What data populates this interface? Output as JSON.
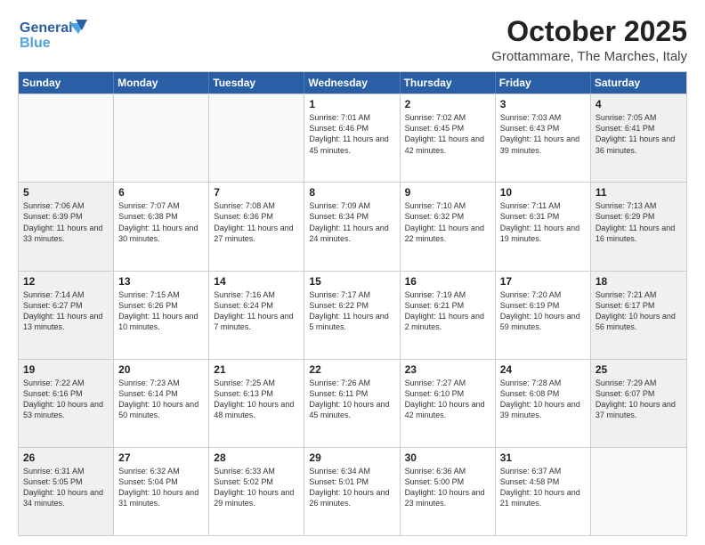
{
  "logo": {
    "line1": "General",
    "line2": "Blue"
  },
  "title": "October 2025",
  "location": "Grottammare, The Marches, Italy",
  "weekdays": [
    "Sunday",
    "Monday",
    "Tuesday",
    "Wednesday",
    "Thursday",
    "Friday",
    "Saturday"
  ],
  "weeks": [
    [
      {
        "day": "",
        "info": "",
        "empty": true
      },
      {
        "day": "",
        "info": "",
        "empty": true
      },
      {
        "day": "",
        "info": "",
        "empty": true
      },
      {
        "day": "1",
        "info": "Sunrise: 7:01 AM\nSunset: 6:46 PM\nDaylight: 11 hours and 45 minutes."
      },
      {
        "day": "2",
        "info": "Sunrise: 7:02 AM\nSunset: 6:45 PM\nDaylight: 11 hours and 42 minutes."
      },
      {
        "day": "3",
        "info": "Sunrise: 7:03 AM\nSunset: 6:43 PM\nDaylight: 11 hours and 39 minutes."
      },
      {
        "day": "4",
        "info": "Sunrise: 7:05 AM\nSunset: 6:41 PM\nDaylight: 11 hours and 36 minutes.",
        "shaded": true
      }
    ],
    [
      {
        "day": "5",
        "info": "Sunrise: 7:06 AM\nSunset: 6:39 PM\nDaylight: 11 hours and 33 minutes.",
        "shaded": true
      },
      {
        "day": "6",
        "info": "Sunrise: 7:07 AM\nSunset: 6:38 PM\nDaylight: 11 hours and 30 minutes."
      },
      {
        "day": "7",
        "info": "Sunrise: 7:08 AM\nSunset: 6:36 PM\nDaylight: 11 hours and 27 minutes."
      },
      {
        "day": "8",
        "info": "Sunrise: 7:09 AM\nSunset: 6:34 PM\nDaylight: 11 hours and 24 minutes."
      },
      {
        "day": "9",
        "info": "Sunrise: 7:10 AM\nSunset: 6:32 PM\nDaylight: 11 hours and 22 minutes."
      },
      {
        "day": "10",
        "info": "Sunrise: 7:11 AM\nSunset: 6:31 PM\nDaylight: 11 hours and 19 minutes."
      },
      {
        "day": "11",
        "info": "Sunrise: 7:13 AM\nSunset: 6:29 PM\nDaylight: 11 hours and 16 minutes.",
        "shaded": true
      }
    ],
    [
      {
        "day": "12",
        "info": "Sunrise: 7:14 AM\nSunset: 6:27 PM\nDaylight: 11 hours and 13 minutes.",
        "shaded": true
      },
      {
        "day": "13",
        "info": "Sunrise: 7:15 AM\nSunset: 6:26 PM\nDaylight: 11 hours and 10 minutes."
      },
      {
        "day": "14",
        "info": "Sunrise: 7:16 AM\nSunset: 6:24 PM\nDaylight: 11 hours and 7 minutes."
      },
      {
        "day": "15",
        "info": "Sunrise: 7:17 AM\nSunset: 6:22 PM\nDaylight: 11 hours and 5 minutes."
      },
      {
        "day": "16",
        "info": "Sunrise: 7:19 AM\nSunset: 6:21 PM\nDaylight: 11 hours and 2 minutes."
      },
      {
        "day": "17",
        "info": "Sunrise: 7:20 AM\nSunset: 6:19 PM\nDaylight: 10 hours and 59 minutes."
      },
      {
        "day": "18",
        "info": "Sunrise: 7:21 AM\nSunset: 6:17 PM\nDaylight: 10 hours and 56 minutes.",
        "shaded": true
      }
    ],
    [
      {
        "day": "19",
        "info": "Sunrise: 7:22 AM\nSunset: 6:16 PM\nDaylight: 10 hours and 53 minutes.",
        "shaded": true
      },
      {
        "day": "20",
        "info": "Sunrise: 7:23 AM\nSunset: 6:14 PM\nDaylight: 10 hours and 50 minutes."
      },
      {
        "day": "21",
        "info": "Sunrise: 7:25 AM\nSunset: 6:13 PM\nDaylight: 10 hours and 48 minutes."
      },
      {
        "day": "22",
        "info": "Sunrise: 7:26 AM\nSunset: 6:11 PM\nDaylight: 10 hours and 45 minutes."
      },
      {
        "day": "23",
        "info": "Sunrise: 7:27 AM\nSunset: 6:10 PM\nDaylight: 10 hours and 42 minutes."
      },
      {
        "day": "24",
        "info": "Sunrise: 7:28 AM\nSunset: 6:08 PM\nDaylight: 10 hours and 39 minutes."
      },
      {
        "day": "25",
        "info": "Sunrise: 7:29 AM\nSunset: 6:07 PM\nDaylight: 10 hours and 37 minutes.",
        "shaded": true
      }
    ],
    [
      {
        "day": "26",
        "info": "Sunrise: 6:31 AM\nSunset: 5:05 PM\nDaylight: 10 hours and 34 minutes.",
        "shaded": true
      },
      {
        "day": "27",
        "info": "Sunrise: 6:32 AM\nSunset: 5:04 PM\nDaylight: 10 hours and 31 minutes."
      },
      {
        "day": "28",
        "info": "Sunrise: 6:33 AM\nSunset: 5:02 PM\nDaylight: 10 hours and 29 minutes."
      },
      {
        "day": "29",
        "info": "Sunrise: 6:34 AM\nSunset: 5:01 PM\nDaylight: 10 hours and 26 minutes."
      },
      {
        "day": "30",
        "info": "Sunrise: 6:36 AM\nSunset: 5:00 PM\nDaylight: 10 hours and 23 minutes."
      },
      {
        "day": "31",
        "info": "Sunrise: 6:37 AM\nSunset: 4:58 PM\nDaylight: 10 hours and 21 minutes."
      },
      {
        "day": "",
        "info": "",
        "empty": true
      }
    ]
  ]
}
